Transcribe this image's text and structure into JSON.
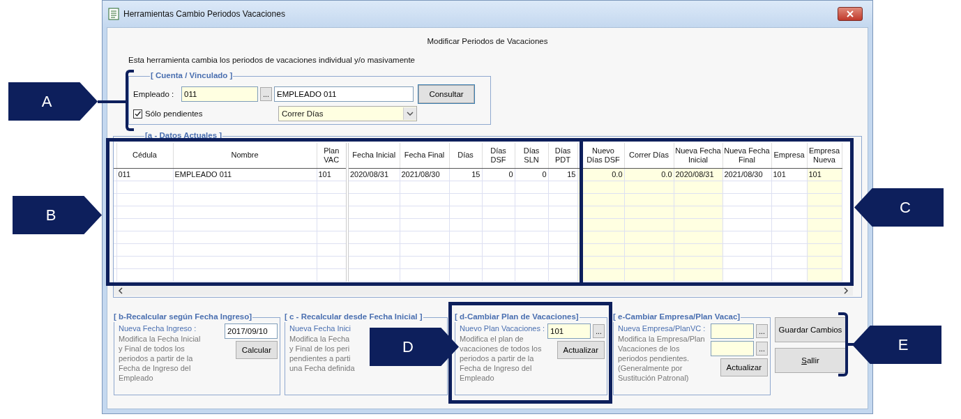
{
  "window": {
    "title": "Herramientas Cambio Periodos Vacaciones"
  },
  "header": "Modificar Periodos de Vacaciones",
  "description": "Esta herramienta cambia los periodos de vacaciones individual y/o masivamente",
  "account_group": {
    "legend": "[ Cuenta / Vinculado ]",
    "employee_label": "Empleado :",
    "employee_code": "011",
    "browse_button": "...",
    "employee_name": "EMPLEADO 011",
    "consult_button": "Consultar",
    "pending_only": {
      "label": "Sólo pendientes",
      "checked": true
    },
    "mode": "Correr Días"
  },
  "data_group": {
    "legend": "[a - Datos Actuales ]"
  },
  "table": {
    "columns": [
      {
        "label": "Cédula",
        "kind": "text",
        "editable": false
      },
      {
        "label": "Nombre",
        "kind": "text",
        "editable": false
      },
      {
        "label": "Plan VAC",
        "kind": "text",
        "editable": false
      },
      {
        "label": "Fecha Inicial",
        "kind": "text",
        "editable": false
      },
      {
        "label": "Fecha Final",
        "kind": "text",
        "editable": false
      },
      {
        "label": "Días",
        "kind": "number",
        "editable": false
      },
      {
        "label": "Días DSF",
        "kind": "number",
        "editable": false
      },
      {
        "label": "Días SLN",
        "kind": "number",
        "editable": false
      },
      {
        "label": "Días PDT",
        "kind": "number",
        "editable": false
      },
      {
        "label": "Nuevo Días DSF",
        "kind": "number",
        "editable": true
      },
      {
        "label": "Correr Días",
        "kind": "number",
        "editable": true
      },
      {
        "label": "Nueva Fecha Inicial",
        "kind": "text",
        "editable": true
      },
      {
        "label": "Nueva Fecha Final",
        "kind": "text",
        "editable": false
      },
      {
        "label": "Empresa",
        "kind": "text",
        "editable": false
      },
      {
        "label": "Empresa Nueva",
        "kind": "text",
        "editable": true
      }
    ],
    "rows": [
      [
        "011",
        "EMPLEADO 011",
        "101",
        "2020/08/31",
        "2021/08/30",
        "15",
        "0",
        "0",
        "15",
        "0.0",
        "0.0",
        "2020/08/31",
        "2021/08/30",
        "101",
        "101"
      ]
    ]
  },
  "panels": [
    {
      "legend": "[ b-Recalcular según Fecha Ingreso]",
      "label": "Nueva Fecha Ingreso :",
      "description": "Modifica la Fecha Inicial\ny Final de todos los\nperiodos a partir de la\nFecha de Ingreso del\nEmpleado",
      "fields": [
        {
          "value": "2017/09/10",
          "highlighted": false
        }
      ],
      "button": "Calcular"
    },
    {
      "legend": "[ c - Recalcular desde Fecha Inicial ]",
      "label": "Nueva Fecha Inici",
      "description": "Modifica la Fecha\ny Final de los peri\npendientes a parti\nuna Fecha definida"
    },
    {
      "legend": "[ d-Cambiar Plan de Vacaciones]",
      "label": "Nuevo Plan Vacaciones :",
      "description": "Modifica el plan de\nvacaciones de todos los\nperiodos a partir de la\nFecha de Ingreso del\nEmpleado",
      "fields": [
        {
          "value": "101",
          "highlighted": true,
          "browse": "..."
        }
      ],
      "button": "Actualizar"
    },
    {
      "legend": "[ e-Cambiar Empresa/Plan Vacac]",
      "label": "Nueva Empresa/PlanVC :",
      "description": "Modifica la Empresa/Plan\nVacaciones de los\nperiodos pendientes.\n(Generalmente por\nSustitución Patronal)",
      "fields": [
        {
          "highlighted": true,
          "browse": "..."
        },
        {
          "highlighted": true,
          "browse": "..."
        }
      ],
      "button": "Actualizar"
    }
  ],
  "side_buttons": [
    "Guardar Cambios",
    "Sallir"
  ],
  "annotations": [
    {
      "label": "A",
      "kind": "rightward"
    },
    {
      "label": "B",
      "kind": "rightward"
    },
    {
      "label": "C",
      "kind": "leftward"
    },
    {
      "label": "D",
      "kind": "rightward"
    },
    {
      "label": "E",
      "kind": "leftward"
    }
  ]
}
